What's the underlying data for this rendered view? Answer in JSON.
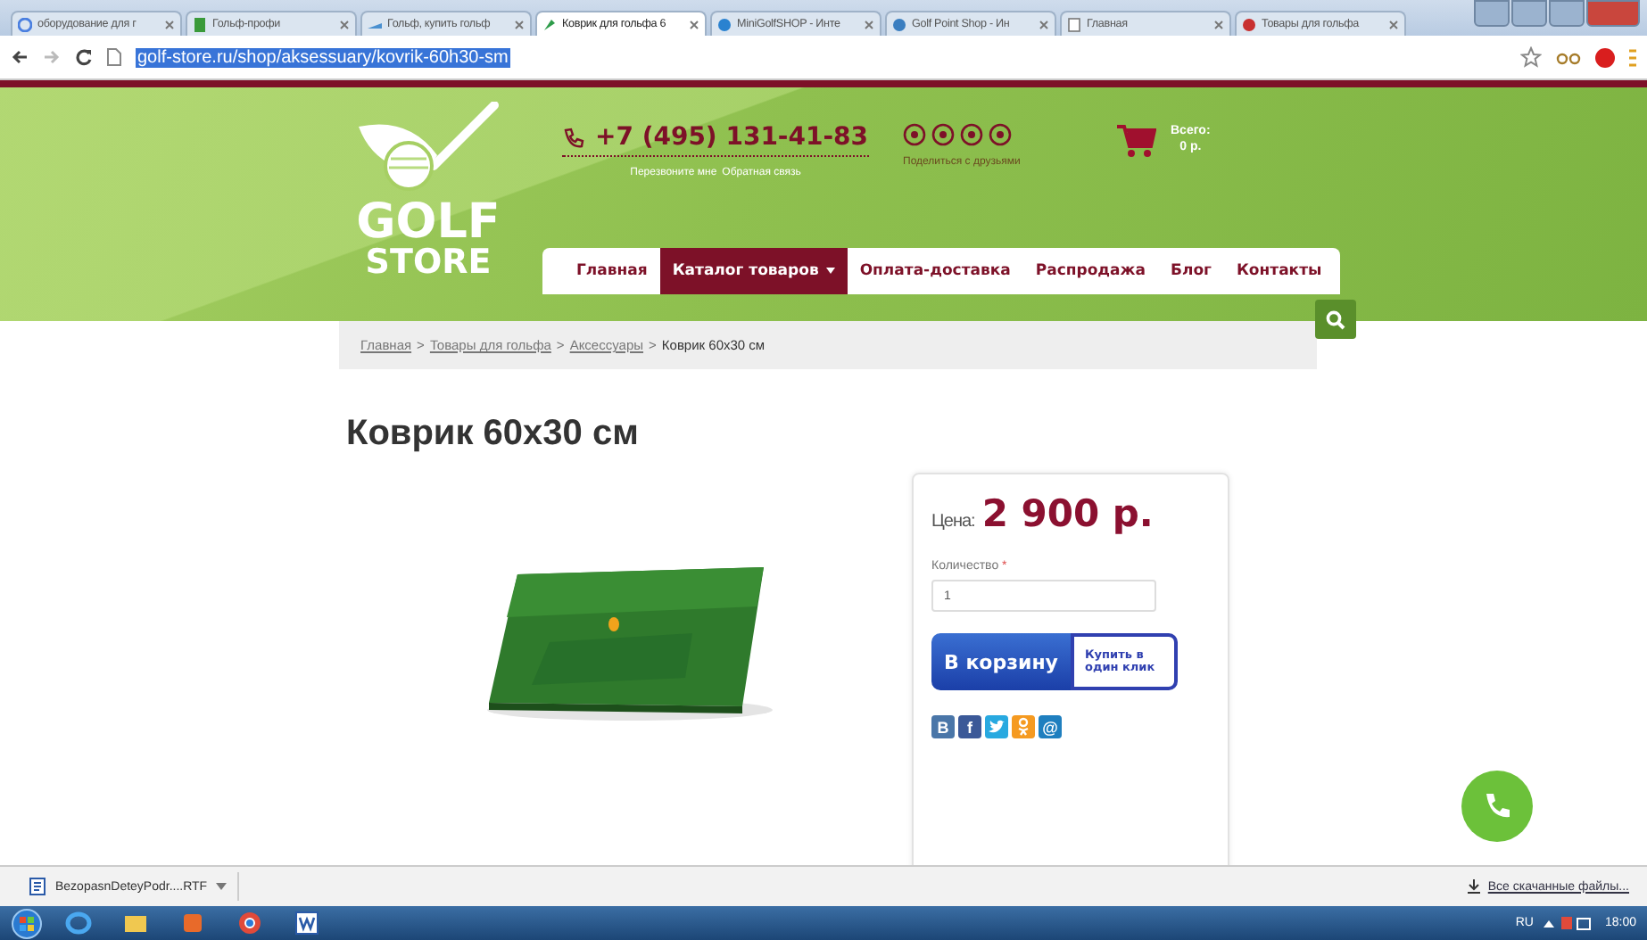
{
  "browser": {
    "tabs": [
      {
        "title": "оборудование для г",
        "selected": false,
        "kind": "google"
      },
      {
        "title": "Гольф-профи",
        "selected": false,
        "kind": "green"
      },
      {
        "title": "Гольф, купить гольф",
        "selected": false,
        "kind": "blue"
      },
      {
        "title": "Коврик для гольфа 6",
        "selected": true,
        "kind": "golf"
      },
      {
        "title": "MiniGolfSHOP - Инте",
        "selected": false,
        "kind": "c"
      },
      {
        "title": "Golf Point Shop - Ин",
        "selected": false,
        "kind": "moon"
      },
      {
        "title": "Главная",
        "selected": false,
        "kind": "page"
      },
      {
        "title": "Товары для гольфа",
        "selected": false,
        "kind": "red"
      }
    ],
    "url": "golf-store.ru/shop/aksessuary/kovrik-60h30-sm",
    "url_selected": true
  },
  "header": {
    "logo": [
      "GOLF",
      "STORE"
    ],
    "phone": "+7 (495) 131-41-83",
    "phone_links": [
      "Перезвоните мне",
      "Обратная связь"
    ],
    "share_label": "Поделиться с друзьями",
    "cart": {
      "label": "Всего:",
      "total": "0 р."
    }
  },
  "nav": [
    {
      "label": "Главная",
      "selected": false,
      "dropdown": false
    },
    {
      "label": "Каталог товаров",
      "selected": true,
      "dropdown": true
    },
    {
      "label": "Оплата-доставка",
      "selected": false,
      "dropdown": false
    },
    {
      "label": "Распродажа",
      "selected": false,
      "dropdown": false
    },
    {
      "label": "Блог",
      "selected": false,
      "dropdown": false
    },
    {
      "label": "Контакты",
      "selected": false,
      "dropdown": false
    }
  ],
  "breadcrumbs": {
    "separator": ">",
    "items": [
      {
        "label": "Главная",
        "link": true
      },
      {
        "label": "Товары для гольфа",
        "link": true
      },
      {
        "label": "Аксессуары",
        "link": true
      },
      {
        "label": "Коврик 60x30 см",
        "link": false
      }
    ]
  },
  "product": {
    "title": "Коврик 60x30 см",
    "price_label": "Цена:",
    "price": "2 900 р.",
    "quantity_label": "Количество",
    "required_mark": "*",
    "quantity": "1",
    "cart_button": "В корзину",
    "one_click_button": "Купить в один клик",
    "share": [
      {
        "kind": "vk",
        "label": "B",
        "color": "#4a76a8"
      },
      {
        "kind": "facebook",
        "label": "f",
        "color": "#3b5998"
      },
      {
        "kind": "twitter",
        "color": "#28a9e0"
      },
      {
        "kind": "ok",
        "color": "#f59a21"
      },
      {
        "kind": "mail",
        "label": "@",
        "color": "#1f7fbf"
      }
    ]
  },
  "downloads": {
    "file": "BezopasnDeteyPodr....RTF",
    "show_all": "Все скачанные файлы..."
  },
  "taskbar": {
    "apps": [
      {
        "kind": "ie"
      },
      {
        "kind": "explorer"
      },
      {
        "kind": "media"
      },
      {
        "kind": "chrome"
      },
      {
        "kind": "word"
      }
    ],
    "language": "RU",
    "time": "18:00"
  }
}
